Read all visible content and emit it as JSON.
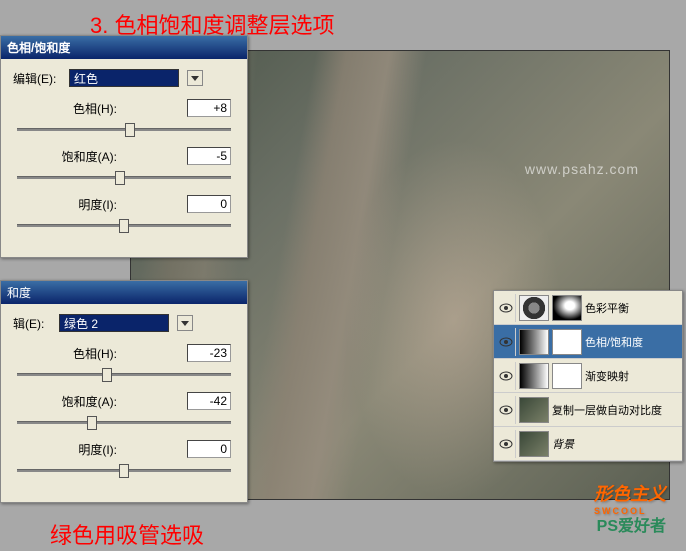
{
  "labels": {
    "top": "3. 色相饱和度调整层选项",
    "bottom": "绿色用吸管选吸"
  },
  "dialog1": {
    "title": "色相/饱和度",
    "edit_label": "编辑(E):",
    "edit_value": "红色",
    "hue_label": "色相(H):",
    "hue_value": "+8",
    "sat_label": "饱和度(A):",
    "sat_value": "-5",
    "light_label": "明度(I):",
    "light_value": "0"
  },
  "dialog2": {
    "title": "和度",
    "edit_label": "辑(E):",
    "edit_value": "绿色 2",
    "hue_label": "色相(H):",
    "hue_value": "-23",
    "sat_label": "饱和度(A):",
    "sat_value": "-42",
    "light_label": "明度(I):",
    "light_value": "0"
  },
  "layers": {
    "row1": "色彩平衡",
    "row2": "色相/饱和度",
    "row3": "渐变映射",
    "row4": "复制一层做自动对比度",
    "row5": "背景"
  },
  "watermark": {
    "brand": "形色主义",
    "sub": "SWCOOL",
    "site": "PS爱好者",
    "psahz": "www.psahz.com"
  }
}
